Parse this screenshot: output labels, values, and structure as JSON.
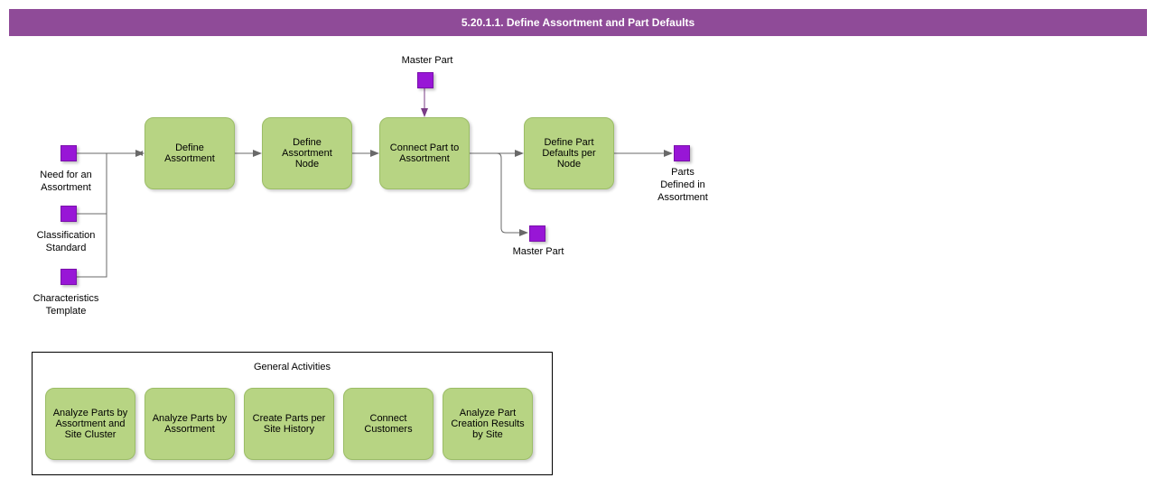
{
  "header": {
    "title": "5.20.1.1. Define Assortment and Part Defaults"
  },
  "inputs": {
    "need": "Need for an\nAssortment",
    "classification": "Classification\nStandard",
    "characteristics": "Characteristics\nTemplate",
    "master_in": "Master Part"
  },
  "process": {
    "define_assortment": "Define\nAssortment",
    "define_node": "Define\nAssortment\nNode",
    "connect_part": "Connect Part to\nAssortment",
    "define_defaults": "Define Part\nDefaults per\nNode"
  },
  "outputs": {
    "master_out": "Master Part",
    "parts_defined": "Parts\nDefined in\nAssortment"
  },
  "general": {
    "title": "General Activities",
    "items": [
      "Analyze Parts by\nAssortment and\nSite Cluster",
      "Analyze Parts by\nAssortment",
      "Create Parts per\nSite History",
      "Connect\nCustomers",
      "Analyze Part\nCreation Results\nby Site"
    ]
  },
  "colors": {
    "accent": "#8f4b98",
    "node": "#b7d483",
    "port": "#9816d6"
  }
}
